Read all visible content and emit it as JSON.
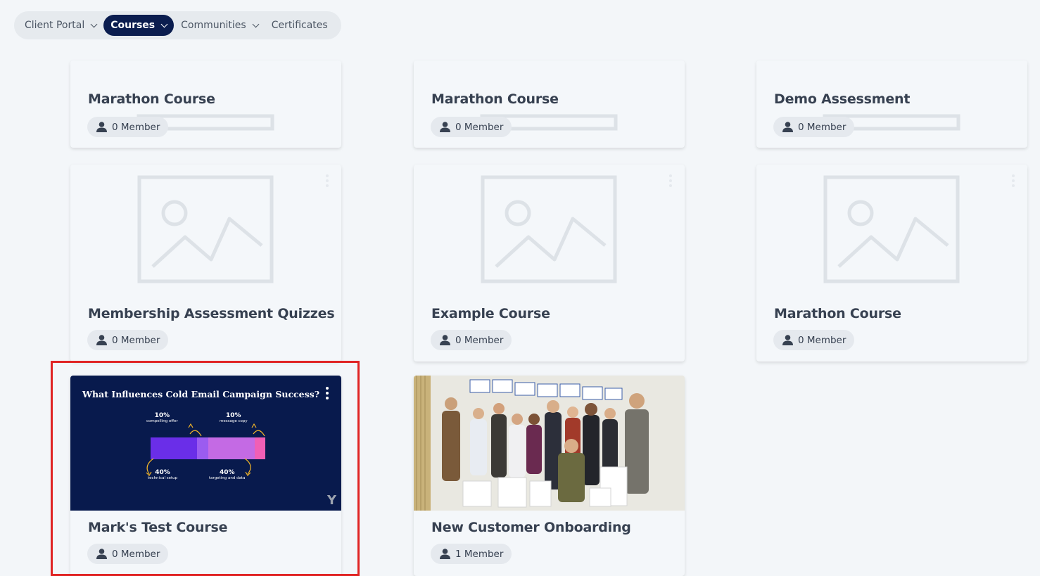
{
  "nav": {
    "items": [
      {
        "label": "Client Portal",
        "dropdown": true,
        "active": false
      },
      {
        "label": "Courses",
        "dropdown": true,
        "active": true
      },
      {
        "label": "Communities",
        "dropdown": true,
        "active": false
      },
      {
        "label": "Certificates",
        "dropdown": false,
        "active": false
      }
    ]
  },
  "cards": [
    {
      "title": "Marathon Course",
      "members": "0 Member",
      "thumbnail": "placeholder-image-icon"
    },
    {
      "title": "Marathon Course",
      "members": "0 Member",
      "thumbnail": "placeholder-image-icon"
    },
    {
      "title": "Demo Assessment",
      "members": "0 Member",
      "thumbnail": "placeholder-image-icon"
    },
    {
      "title": "Membership Assessment Quizzes",
      "members": "0 Member",
      "thumbnail": "placeholder-image-icon"
    },
    {
      "title": "Example Course",
      "members": "0 Member",
      "thumbnail": "placeholder-image-icon"
    },
    {
      "title": "Marathon Course",
      "members": "0 Member",
      "thumbnail": "placeholder-image-icon"
    },
    {
      "title": "Mark's Test Course",
      "members": "0 Member",
      "highlighted": true,
      "thumbnail": "infographic",
      "infographic": {
        "title": "What Influences Cold Email Campaign Success?",
        "segments": [
          {
            "pct": "10%",
            "label": "compelling offer"
          },
          {
            "pct": "10%",
            "label": "message copy"
          },
          {
            "pct": "40%",
            "label": "technical setup"
          },
          {
            "pct": "40%",
            "label": "targeting and data"
          }
        ]
      }
    },
    {
      "title": "New Customer Onboarding",
      "members": "1 Member",
      "thumbnail": "group-photo"
    }
  ],
  "colors": {
    "nav_active_bg": "#0b1d4f",
    "highlight_border": "#e02424",
    "infographic_bg": "#081a4d"
  }
}
